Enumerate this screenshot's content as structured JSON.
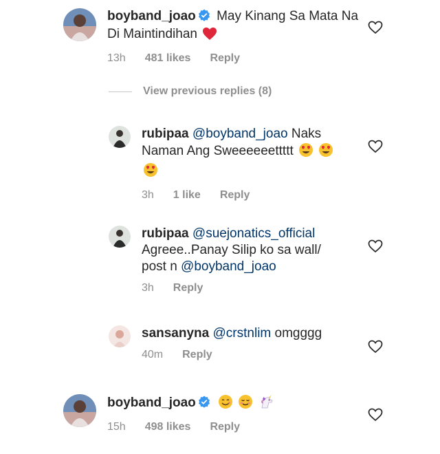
{
  "comments": [
    {
      "username": "boyband_joao",
      "verified": true,
      "mention": "",
      "text": "May Kinang Sa Mata Na Di Maintindihan",
      "emoji": [
        "red-heart"
      ],
      "time": "13h",
      "likes": "481 likes",
      "reply": "Reply"
    },
    {
      "username": "rubipaa",
      "verified": false,
      "mention": "@boyband_joao",
      "text": "Naks Naman Ang Sweeeeeettttt",
      "emoji": [
        "heart-eyes",
        "heart-eyes",
        "heart-eyes"
      ],
      "time": "3h",
      "likes": "1 like",
      "reply": "Reply"
    },
    {
      "username": "rubipaa",
      "verified": false,
      "mention": "@suejonatics_official",
      "text": "Agreee..Panay Silip ko sa wall/ post n",
      "mention2": "@boyband_joao",
      "time": "3h",
      "reply": "Reply"
    },
    {
      "username": "sansanyna",
      "verified": false,
      "mention": "@crstnlim",
      "text": "omgggg",
      "time": "40m",
      "reply": "Reply"
    },
    {
      "username": "boyband_joao",
      "verified": true,
      "emoji": [
        "smiling-face",
        "relieved-face",
        "unicorn"
      ],
      "time": "15h",
      "likes": "498 likes",
      "reply": "Reply"
    }
  ],
  "view_previous": "View previous replies (8)",
  "colors": {
    "text": "#262626",
    "meta": "#8e8e8e",
    "mention": "#003569",
    "verified": "#3897f0"
  }
}
